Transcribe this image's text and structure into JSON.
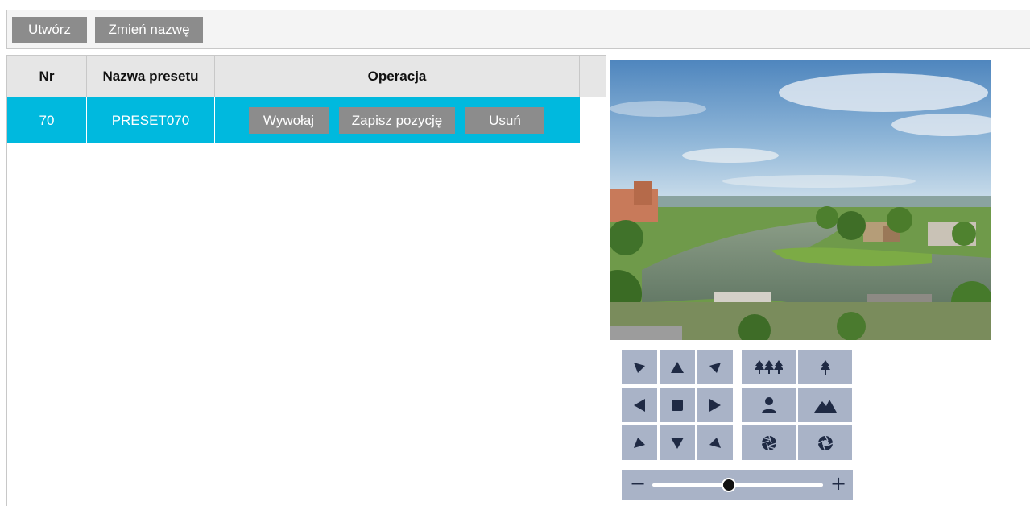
{
  "toolbar": {
    "create_label": "Utwórz",
    "rename_label": "Zmień nazwę"
  },
  "table": {
    "columns": [
      "Nr",
      "Nazwa presetu",
      "Operacja"
    ],
    "rows": [
      {
        "nr": "70",
        "name": "PRESET070",
        "call_label": "Wywołaj",
        "save_label": "Zapisz pozycję",
        "delete_label": "Usuń"
      }
    ]
  },
  "ptz": {
    "directions": [
      "up-left",
      "up",
      "up-right",
      "left",
      "stop",
      "right",
      "down-left",
      "down",
      "down-right"
    ],
    "lens": [
      "zoom-out-icon",
      "zoom-in-icon",
      "focus-near-icon",
      "focus-far-icon",
      "iris-close-icon",
      "iris-open-icon"
    ],
    "speed_minus": "−",
    "speed_plus": "+",
    "speed_level": 0.45
  },
  "colors": {
    "selected_row": "#00b9de",
    "button": "#8c8c8c",
    "ptz_button": "#a9b3c7",
    "icon": "#1f2a44"
  }
}
